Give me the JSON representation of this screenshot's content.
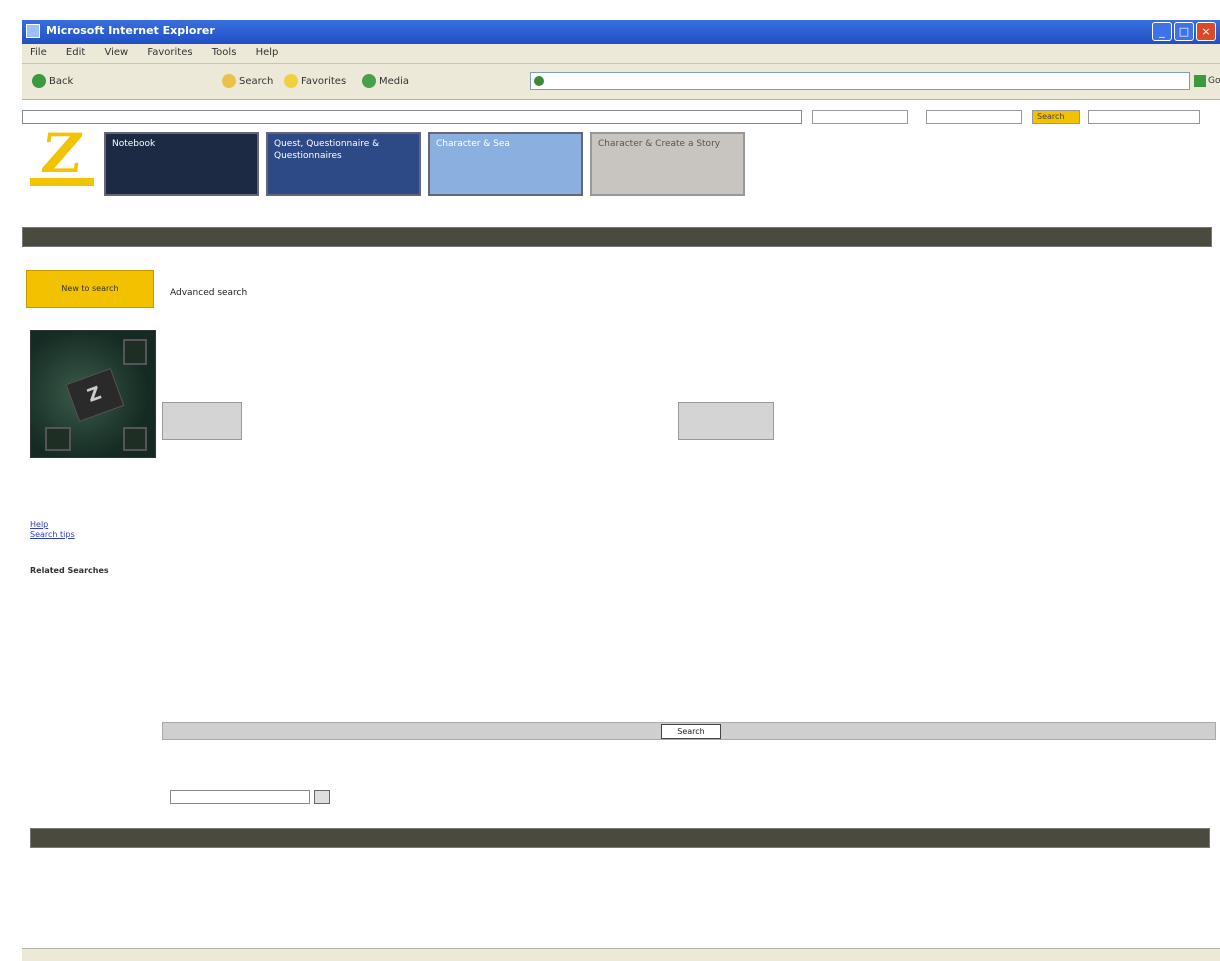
{
  "window": {
    "title": "Microsoft Internet Explorer"
  },
  "menu": [
    "File",
    "Edit",
    "View",
    "Favorites",
    "Tools",
    "Help"
  ],
  "toolbar": {
    "back": "Back",
    "search": "Search",
    "favorites": "Favorites",
    "media": "Media",
    "go": "Go"
  },
  "page": {
    "banners": [
      {
        "label": "Notebook",
        "color": "#1c2a44"
      },
      {
        "label": "Quest, Questionnaire & Questionnaires",
        "color": "#2e4a86"
      },
      {
        "label": "Character & Sea",
        "color": "#8ab0e0"
      },
      {
        "label": "Character & Create a Story",
        "color": "#c8c5c0"
      }
    ],
    "top_button": "Search",
    "yellow_button": "New to search",
    "title": "Advanced search",
    "left_links": [
      "Help",
      "Search tips"
    ],
    "left_heading": "Related Searches",
    "submit": "Search"
  }
}
